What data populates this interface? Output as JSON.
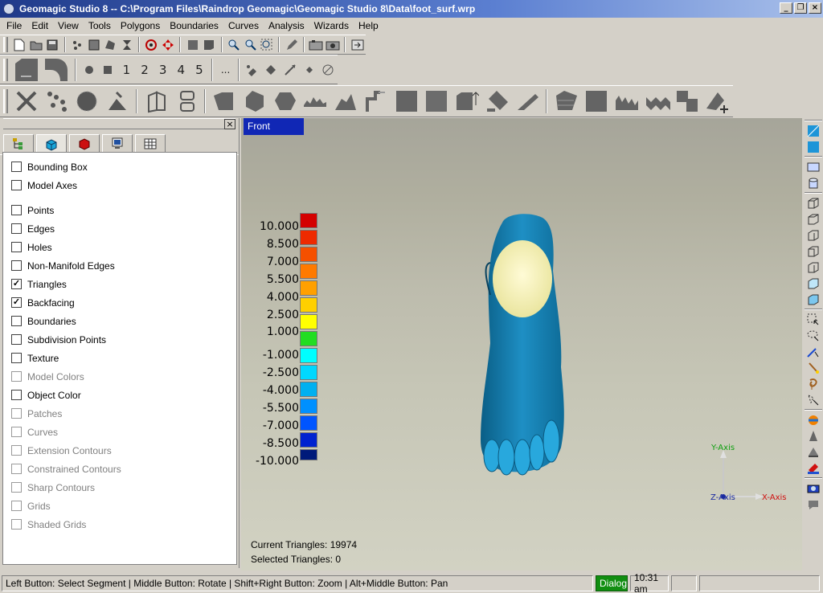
{
  "window": {
    "title": "Geomagic Studio 8 -- C:\\Program Files\\Raindrop Geomagic\\Geomagic Studio 8\\Data\\foot_surf.wrp"
  },
  "menu": [
    "File",
    "Edit",
    "View",
    "Tools",
    "Polygons",
    "Boundaries",
    "Curves",
    "Analysis",
    "Wizards",
    "Help"
  ],
  "toolbar2": {
    "numbers": [
      "1",
      "2",
      "3",
      "4",
      "5"
    ],
    "more": "..."
  },
  "display_panel": {
    "items": [
      {
        "label": "Bounding Box",
        "checked": false,
        "enabled": true
      },
      {
        "label": "Model Axes",
        "checked": false,
        "enabled": true
      },
      {
        "label": "Points",
        "checked": false,
        "enabled": true
      },
      {
        "label": "Edges",
        "checked": false,
        "enabled": true
      },
      {
        "label": "Holes",
        "checked": false,
        "enabled": true
      },
      {
        "label": "Non-Manifold Edges",
        "checked": false,
        "enabled": true
      },
      {
        "label": "Triangles",
        "checked": true,
        "enabled": true
      },
      {
        "label": "Backfacing",
        "checked": true,
        "enabled": true
      },
      {
        "label": "Boundaries",
        "checked": false,
        "enabled": true
      },
      {
        "label": "Subdivision Points",
        "checked": false,
        "enabled": true
      },
      {
        "label": "Texture",
        "checked": false,
        "enabled": true
      },
      {
        "label": "Model Colors",
        "checked": false,
        "enabled": false
      },
      {
        "label": "Object Color",
        "checked": false,
        "enabled": true
      },
      {
        "label": "Patches",
        "checked": false,
        "enabled": false
      },
      {
        "label": "Curves",
        "checked": false,
        "enabled": false
      },
      {
        "label": "Extension Contours",
        "checked": false,
        "enabled": false
      },
      {
        "label": "Constrained Contours",
        "checked": false,
        "enabled": false
      },
      {
        "label": "Sharp Contours",
        "checked": false,
        "enabled": false
      },
      {
        "label": "Grids",
        "checked": false,
        "enabled": false
      },
      {
        "label": "Shaded Grids",
        "checked": false,
        "enabled": false
      }
    ],
    "check_mark": "✓"
  },
  "viewport": {
    "view_label": "Front",
    "legend": {
      "labels": [
        "10.000",
        "8.500",
        "7.000",
        "5.500",
        "4.000",
        "2.500",
        "1.000",
        "-1.000",
        "-2.500",
        "-4.000",
        "-5.500",
        "-7.000",
        "-8.500",
        "-10.000"
      ],
      "colors": [
        "#d40000",
        "#ee2a00",
        "#f55000",
        "#ff7a00",
        "#ffa000",
        "#ffd000",
        "#ffff00",
        "#22dd22",
        "#00ffff",
        "#00d8ff",
        "#00b0f0",
        "#0090ff",
        "#0055ff",
        "#0022d0",
        "#001a7a"
      ]
    },
    "axes": {
      "y": "Y-Axis",
      "x": "X-Axis",
      "z": "Z-Axis"
    },
    "current_triangles": "Current Triangles: 19974",
    "selected_triangles": "Selected Triangles: 0"
  },
  "statusbar": {
    "hint": "Left Button: Select Segment | Middle Button: Rotate | Shift+Right Button: Zoom | Alt+Middle Button: Pan",
    "mode": "Dialog",
    "time": "10:31 am"
  }
}
